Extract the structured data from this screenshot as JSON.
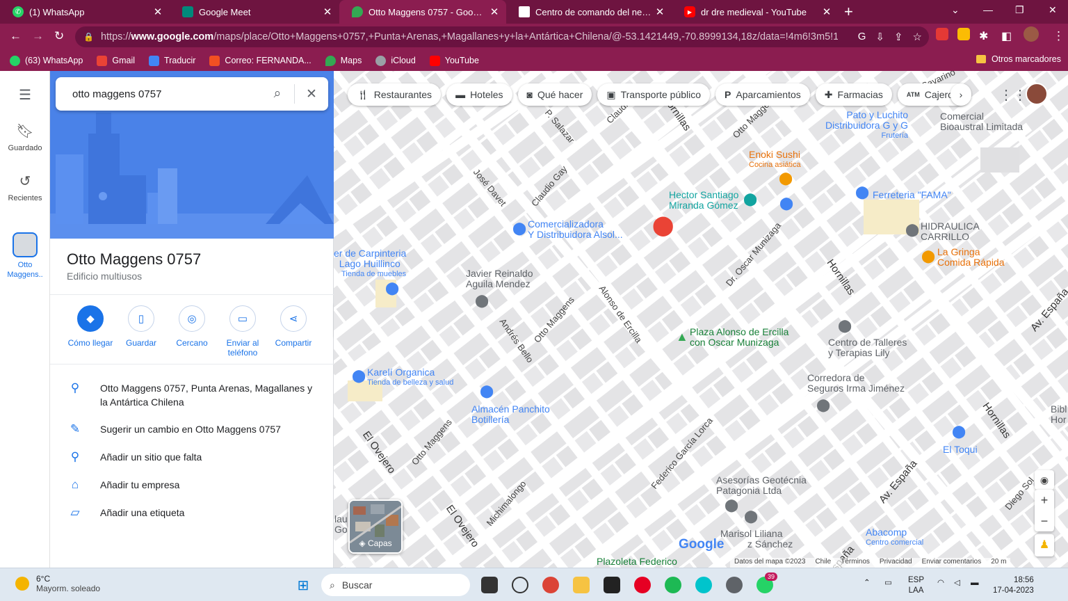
{
  "tabs": [
    {
      "title": "(1) WhatsApp",
      "icon": "whatsapp-icon"
    },
    {
      "title": "Google Meet",
      "icon": "meet-icon"
    },
    {
      "title": "Otto Maggens 0757 - Google Maps",
      "icon": "maps-icon",
      "active": true
    },
    {
      "title": "Centro de comando del negocio",
      "icon": "page-icon"
    },
    {
      "title": "dr dre medieval - YouTube",
      "icon": "youtube-icon"
    }
  ],
  "browser": {
    "url_prefix": "https://",
    "url_host": "www.google.com",
    "url_path": "/maps/place/Otto+Maggens+0757,+Punta+Arenas,+Magallanes+y+la+Antártica+Chilena/@-53.1421449,-70.8999134,18z/data=!4m6!3m5!1s0x..."
  },
  "bookmarks": [
    {
      "label": "(63) WhatsApp",
      "color": "#25d366"
    },
    {
      "label": "Gmail",
      "color": "#ea4335"
    },
    {
      "label": "Traducir",
      "color": "#4285f4"
    },
    {
      "label": "Correo: FERNANDA...",
      "color": "#f25022"
    },
    {
      "label": "Maps",
      "color": "#34a853"
    },
    {
      "label": "iCloud",
      "color": "#9aa0a6"
    },
    {
      "label": "YouTube",
      "color": "#ff0000"
    }
  ],
  "other_bookmarks": "Otros marcadores",
  "rail": {
    "saved": "Guardado",
    "recents": "Recientes",
    "current": "Otto Maggens.."
  },
  "search": {
    "query": "otto maggens 0757"
  },
  "place": {
    "title": "Otto Maggens 0757",
    "subtitle": "Edificio multiusos"
  },
  "actions": [
    {
      "label": "Cómo llegar"
    },
    {
      "label": "Guardar"
    },
    {
      "label": "Cercano"
    },
    {
      "label": "Enviar al teléfono"
    },
    {
      "label": "Compartir"
    }
  ],
  "info": [
    {
      "text": "Otto Maggens 0757, Punta Arenas, Magallanes y la Antártica Chilena",
      "icon": "location-pin-icon"
    },
    {
      "text": "Sugerir un cambio en Otto Maggens 0757",
      "icon": "pencil-icon"
    },
    {
      "text": "Añadir un sitio que falta",
      "icon": "add-location-icon"
    },
    {
      "text": "Añadir tu empresa",
      "icon": "add-business-icon"
    },
    {
      "text": "Añadir una etiqueta",
      "icon": "label-icon"
    }
  ],
  "chips": [
    {
      "label": "Restaurantes",
      "icon": "restaurant-icon"
    },
    {
      "label": "Hoteles",
      "icon": "hotel-icon"
    },
    {
      "label": "Qué hacer",
      "icon": "camera-icon"
    },
    {
      "label": "Transporte público",
      "icon": "transit-icon"
    },
    {
      "label": "Aparcamientos",
      "icon": "parking-icon"
    },
    {
      "label": "Farmacias",
      "icon": "pharmacy-icon"
    },
    {
      "label": "Cajeros",
      "icon": "atm-icon"
    }
  ],
  "pois": {
    "pato": {
      "name": "Pato y Luchito",
      "name2": "Distribuidora G y G",
      "sub": "Frutería"
    },
    "comercial": {
      "name": "Comercial",
      "name2": "Bioaustral Limitada"
    },
    "enoki": {
      "name": "Enoki Sushi",
      "sub": "Cocina asiática"
    },
    "hector": {
      "name": "Hector Santiago",
      "name2": "Miranda Gómez"
    },
    "ferreteria": {
      "name": "Ferreteria \"FAMA\""
    },
    "hidraulica": {
      "name": "HIDRAULICA",
      "name2": "CARRILLO"
    },
    "gringa": {
      "name": "La Gringa",
      "name2": "Comida Rápida"
    },
    "comercializadora": {
      "name": "Comercializadora",
      "name2": "Y Distribuidora Alsol..."
    },
    "carpinteria": {
      "name": "er de Carpinteria",
      "name2": "Lago Huillinco",
      "sub": "Tienda de muebles"
    },
    "javier": {
      "name": "Javier Reinaldo",
      "name2": "Aguila Mendez"
    },
    "plaza": {
      "name": "Plaza Alonso de Ercilla",
      "name2": "con Oscar Munizaga"
    },
    "talleres": {
      "name": "Centro de Talleres",
      "name2": "y Terapias Lily"
    },
    "kareli": {
      "name": "Karelí Organica",
      "sub": "Tienda de belleza y salud"
    },
    "almacen": {
      "name": "Almacén Panchito",
      "name2": "Botillería"
    },
    "corredora": {
      "name": "Corredora de",
      "name2": "Seguros Irma Jiménez"
    },
    "toqui": {
      "name": "El Toqui"
    },
    "asesorias": {
      "name": "Asesorías Geotécnia",
      "name2": "Patagonia Ltda"
    },
    "marisol": {
      "name": "Marisol Liliana",
      "name2": "z Sánchez"
    },
    "abacomp": {
      "name": "Abacomp",
      "sub": "Centro comercial"
    },
    "plazoleta": {
      "name": "Plazoleta Federico"
    },
    "bibl": {
      "name": "Bibl",
      "name2": "Hor"
    },
    "lau": {
      "name": "lau",
      "name2": "Go"
    }
  },
  "streets": {
    "psalazar": "P. Salazar",
    "claudio": "Claudio",
    "hornillas": "Hornillas",
    "ottomaggens": "Otto Maggens",
    "josedavet": "José Davet",
    "claudiogay": "Claudio Gay",
    "oscarmunizaga": "Dr. Oscar Munizaga",
    "alonso": "Alonso de Ercilla",
    "andresbello": "Andrés Bello",
    "avespana": "Av. España",
    "elovejero": "El Ovejero",
    "federico": "Federico García Lorca",
    "michimalongo": "Michimalongo",
    "diegosol": "Diego Sol",
    "savarino": "Savarino",
    "espana_partial": "spaña"
  },
  "map": {
    "layers": "Capas",
    "google": "Google",
    "attribution": [
      "Datos del mapa ©2023",
      "Chile",
      "Términos",
      "Privacidad",
      "Enviar comentarios",
      "20 m"
    ]
  },
  "taskbar": {
    "weather_temp": "6°C",
    "weather_desc": "Mayorm. soleado",
    "search": "Buscar",
    "lang1": "ESP",
    "lang2": "LAA",
    "time": "18:56",
    "date": "17-04-2023",
    "whatsapp_badge": "39"
  }
}
